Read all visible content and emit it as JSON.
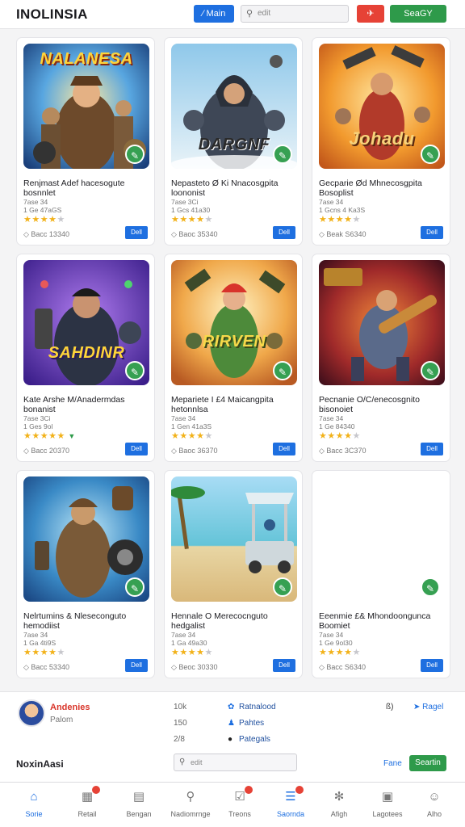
{
  "header": {
    "brand": "INOLINSIA",
    "main_button": "∕ Main",
    "search_placeholder": "edit",
    "red_icon": "✈",
    "green_button": "SeaGY"
  },
  "cards": [
    {
      "thumb_title": "NALANESA",
      "title": "Renjmast Adef hacesogute bosnnlet",
      "sub1": "7ase 34",
      "sub2": "1 Ge 47aGS",
      "rating": 4,
      "size": "Bacc 13340",
      "button": "Dell"
    },
    {
      "thumb_title": "DARGNF",
      "title": "Nepasteto Ø Ki Nnacosgpita loononist",
      "sub1": "7ase 3Ci",
      "sub2": "1 Gcs 41a30",
      "rating": 4,
      "size": "Baoc 35340",
      "button": "Dell"
    },
    {
      "thumb_title": "Johadu",
      "title": "Gecparie Ød Mhnecosgpita Bosoplist",
      "sub1": "7ase 34",
      "sub2": "1 Gcns 4 Ka3S",
      "rating": 4,
      "size": "Beak S6340",
      "button": "Dell"
    },
    {
      "thumb_title": "SAHDINR",
      "title": "Kate Arshe M/Anadermdas bonanist",
      "sub1": "7ase 3Ci",
      "sub2": "1 Ges 9ol",
      "rating": 5,
      "size": "Bacc 20370",
      "button": "Dell"
    },
    {
      "thumb_title": "RIRVEN",
      "title": "Mepariete I £4 Maicangpita hetonnlsa",
      "sub1": "7ase 34",
      "sub2": "1 Gen 41a3S",
      "rating": 4,
      "size": "Baoc 36370",
      "button": "Dell"
    },
    {
      "thumb_title": "",
      "title": "Pecnanie O/C/enecosgnito bisonoiet",
      "sub1": "7ase 34",
      "sub2": "1 Ge 84340",
      "rating": 4,
      "size": "Bacc 3C370",
      "button": "Dell"
    },
    {
      "thumb_title": "",
      "title": "Nelrtumins & Nleseconguto hemodiist",
      "sub1": "7ase 34",
      "sub2": "1 Ga 4ti9S",
      "rating": 4,
      "size": "Bacc 53340",
      "button": "Dell"
    },
    {
      "thumb_title": "",
      "title": "Hennale O Merecocnguto hedgalist",
      "sub1": "7ase 34",
      "sub2": "1 Ga 49a30",
      "rating": 4,
      "size": "Beoc 30330",
      "button": "Dell"
    },
    {
      "thumb_title": "",
      "title": "Eeenmie £& Mhondoongunca Boomiet",
      "sub1": "7ase 34",
      "sub2": "1 Ge 9ol30",
      "rating": 4,
      "size": "Bacc S6340",
      "button": "Dell"
    }
  ],
  "footer": {
    "user_name": "Andenies",
    "user_sub": "Palom",
    "numbers": [
      "10k",
      "150",
      "2/8"
    ],
    "links": [
      "Ratnalood",
      "Pahtes",
      "Pategals"
    ],
    "right_mini": "ß)",
    "right_link": "Ragel",
    "title": "NoxinAasi",
    "search_placeholder": "edit",
    "fane": "Fane",
    "search_button": "Seartin"
  },
  "tabs": [
    {
      "label": "Sorie",
      "icon": "home-icon",
      "active": true
    },
    {
      "label": "Retail",
      "icon": "retail-icon",
      "badge": true
    },
    {
      "label": "Bengan",
      "icon": "document-icon"
    },
    {
      "label": "Nadiomrnge",
      "icon": "location-icon"
    },
    {
      "label": "Treons",
      "icon": "check-icon",
      "badge": true
    },
    {
      "label": "Saornda",
      "icon": "list-icon",
      "badge": true,
      "active": true
    },
    {
      "label": "Afigh",
      "icon": "bug-icon"
    },
    {
      "label": "Lagotees",
      "icon": "box-icon"
    },
    {
      "label": "Alho",
      "icon": "user-icon"
    }
  ],
  "colors": {
    "accent": "#1e6fe0",
    "green": "#2e9a4a",
    "red": "#e64236",
    "star": "#f2b21a"
  }
}
